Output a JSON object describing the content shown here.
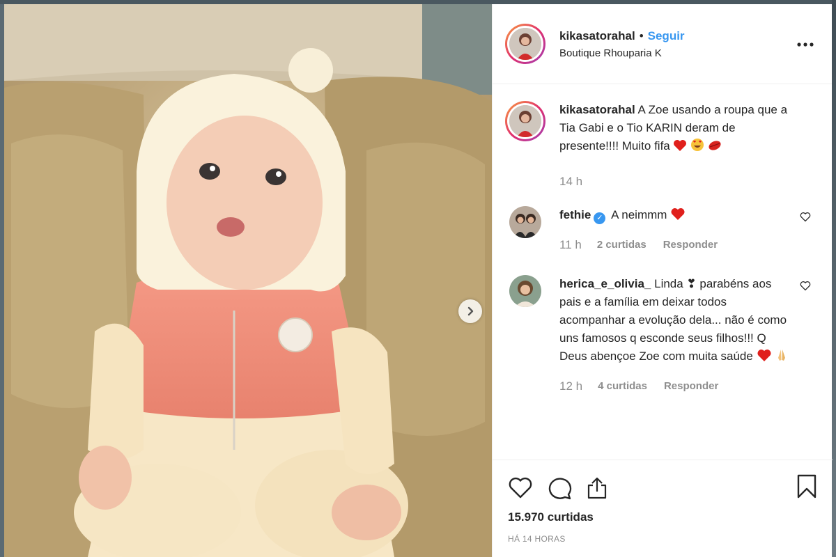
{
  "post": {
    "username": "kikasatorahal",
    "dot": "•",
    "follow_label": "Seguir",
    "location": "Boutique Rhouparia K",
    "photo_alt": "baby-photo"
  },
  "caption": {
    "username": "kikasatorahal",
    "text": "A Zoe usando a roupa que a Tia Gabi e o Tio KARIN deram de presente!!!! Muito fifa",
    "time": "14 h"
  },
  "comments": [
    {
      "username": "fethie",
      "text": "A neimmm",
      "time": "11 h",
      "likes": "2 curtidas",
      "reply": "Responder"
    },
    {
      "username": "herica_e_olivia_",
      "text": "Linda ❣ parabéns aos pais e a família em deixar todos acompanhar a evolução dela... não é como uns famosos q esconde seus filhos!!! Q Deus abençoe Zoe com muita saúde",
      "time": "12 h",
      "likes": "4 curtidas",
      "reply": "Responder"
    }
  ],
  "footer": {
    "likes_count": "15.970 curtidas",
    "time_ago": "HÁ 14 HORAS"
  },
  "colors": {
    "link_blue": "#3897f0",
    "heart_red": "#ed4956",
    "muted_gray": "#8e8e8e"
  },
  "icons": {
    "more": "more-options-icon",
    "next": "chevron-right-icon",
    "like": "heart-icon",
    "comment": "comment-icon",
    "share": "share-icon",
    "save": "bookmark-icon"
  }
}
